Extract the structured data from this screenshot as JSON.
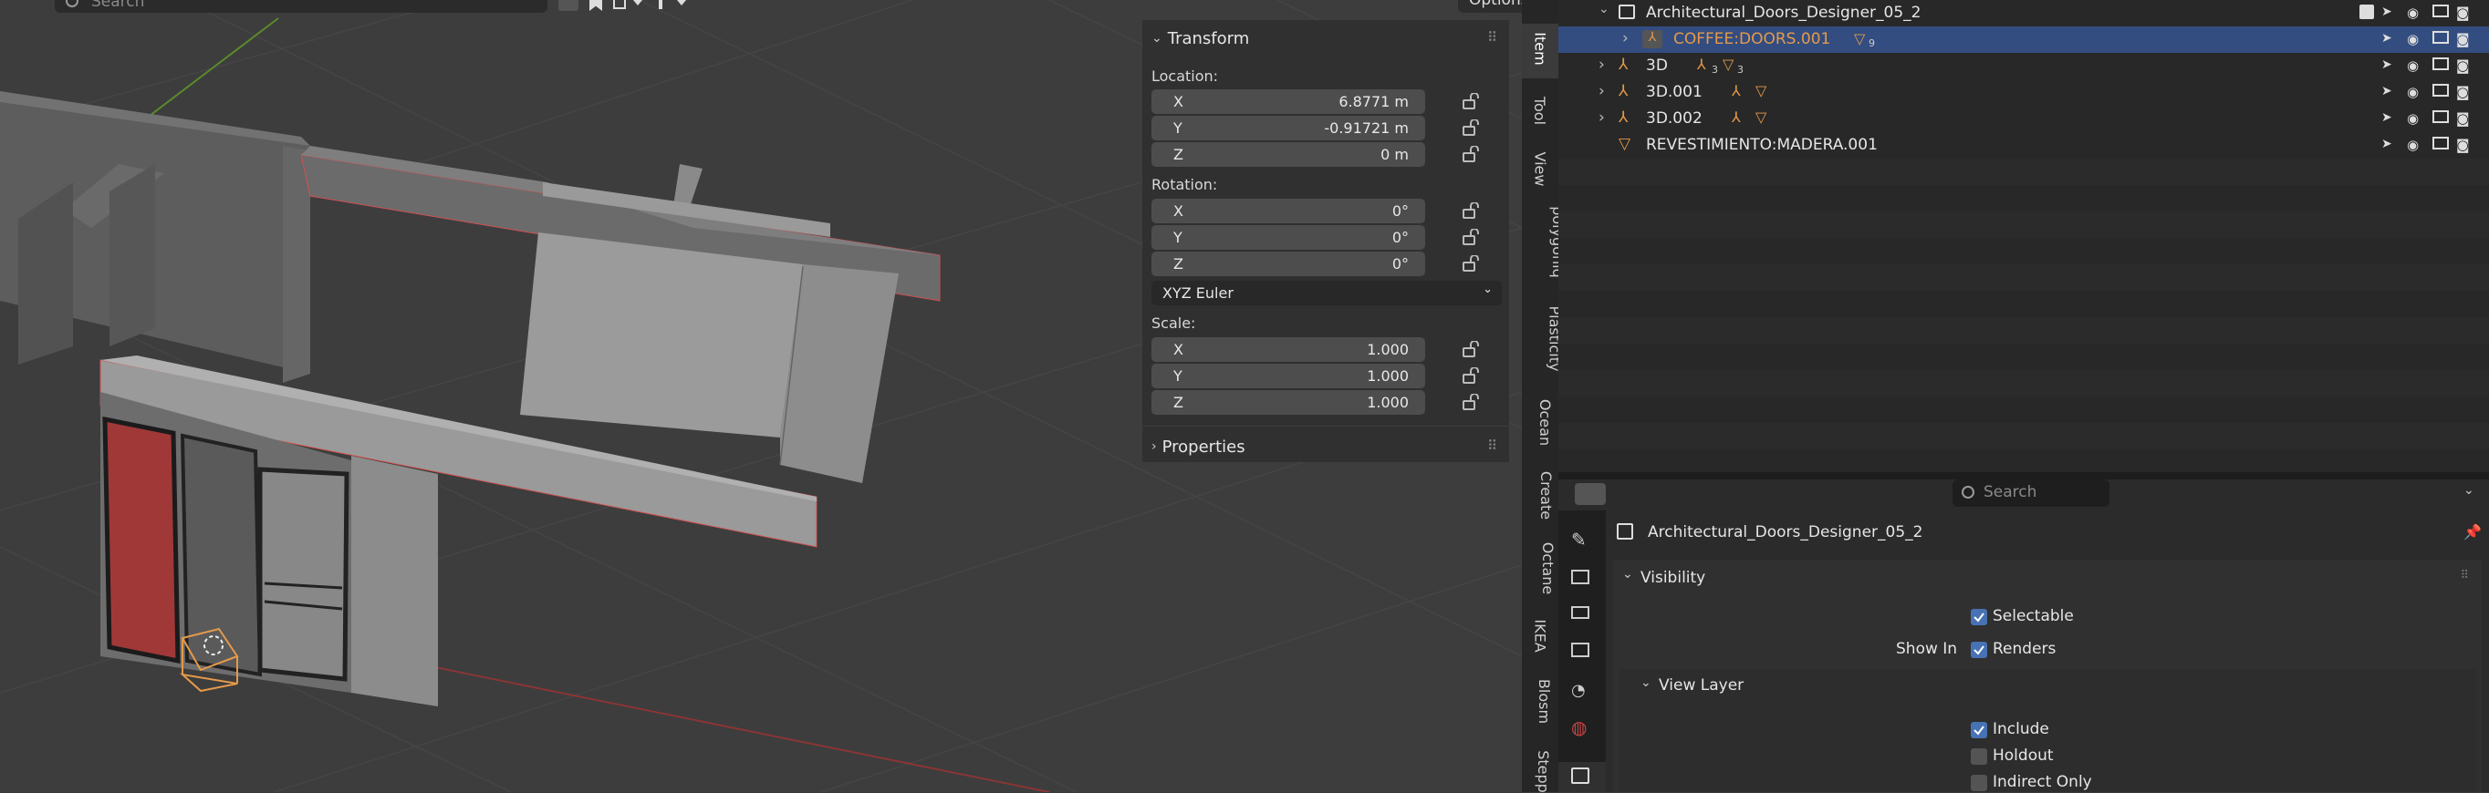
{
  "viewport": {
    "search_placeholder": "Search",
    "options_label": "Options",
    "header_icons": [
      "transform-icon",
      "bookmark-icon",
      "snap-icon",
      "pivot-icon"
    ]
  },
  "npanel": {
    "transform_label": "Transform",
    "location_label": "Location:",
    "location": [
      {
        "axis": "X",
        "value": "6.8771 m"
      },
      {
        "axis": "Y",
        "value": "-0.91721 m"
      },
      {
        "axis": "Z",
        "value": "0 m"
      }
    ],
    "rotation_label": "Rotation:",
    "rotation": [
      {
        "axis": "X",
        "value": "0°"
      },
      {
        "axis": "Y",
        "value": "0°"
      },
      {
        "axis": "Z",
        "value": "0°"
      }
    ],
    "rotation_mode": "XYZ Euler",
    "scale_label": "Scale:",
    "scale": [
      {
        "axis": "X",
        "value": "1.000"
      },
      {
        "axis": "Y",
        "value": "1.000"
      },
      {
        "axis": "Z",
        "value": "1.000"
      }
    ],
    "properties_label": "Properties"
  },
  "tabs": [
    "Item",
    "Tool",
    "View",
    "polygoniq",
    "Plasticity",
    "Ocean",
    "Create",
    "Octane",
    "IKEA",
    "Blosm",
    "Stepp"
  ],
  "outliner": {
    "collection": "Architectural_Doors_Designer_05_2",
    "rows": [
      {
        "name": "COFFEE:DOORS.001",
        "badge": "9",
        "selected": true
      },
      {
        "name": "3D",
        "badge": "3",
        "badge2": "3"
      },
      {
        "name": "3D.001"
      },
      {
        "name": "3D.002"
      },
      {
        "name": "REVESTIMIENTO:MADERA.001"
      }
    ]
  },
  "properties": {
    "search_placeholder": "Search",
    "title": "Architectural_Doors_Designer_05_2",
    "visibility_label": "Visibility",
    "selectable_label": "Selectable",
    "show_in_label": "Show In",
    "renders_label": "Renders",
    "view_layer_label": "View Layer",
    "include_label": "Include",
    "holdout_label": "Holdout",
    "indirect_label": "Indirect Only",
    "checks": {
      "selectable": true,
      "renders": true,
      "include": true,
      "holdout": false,
      "indirect": false
    }
  },
  "colors": {
    "selection": "#334d80",
    "accent": "#4772b3",
    "object_orange": "#e59a4a",
    "wire_red": "#e03c3c"
  }
}
